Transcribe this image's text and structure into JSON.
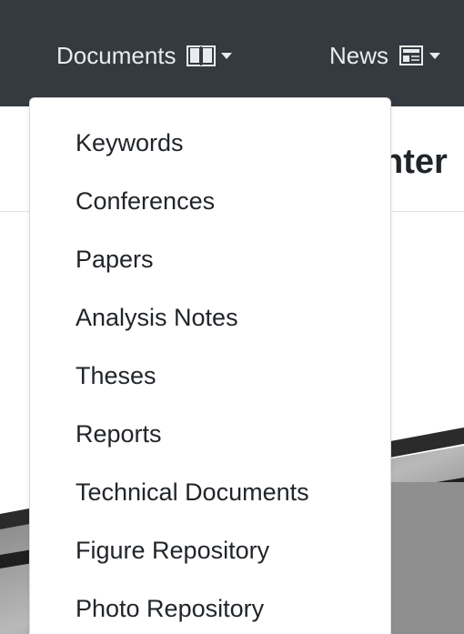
{
  "navbar": {
    "documents_label": "Documents",
    "news_label": "News",
    "documents_icon": "book-icon",
    "news_icon": "newspaper-icon"
  },
  "page": {
    "heading_fragment": "nter"
  },
  "dropdown": {
    "items": [
      {
        "label": "Keywords"
      },
      {
        "label": "Conferences"
      },
      {
        "label": "Papers"
      },
      {
        "label": "Analysis Notes"
      },
      {
        "label": "Theses"
      },
      {
        "label": "Reports"
      },
      {
        "label": "Technical Documents"
      },
      {
        "label": "Figure Repository"
      },
      {
        "label": "Photo Repository"
      }
    ]
  },
  "colors": {
    "navbar_bg": "#343a40",
    "nav_text": "#e9ecef",
    "dropdown_bg": "#ffffff",
    "text": "#212529"
  }
}
